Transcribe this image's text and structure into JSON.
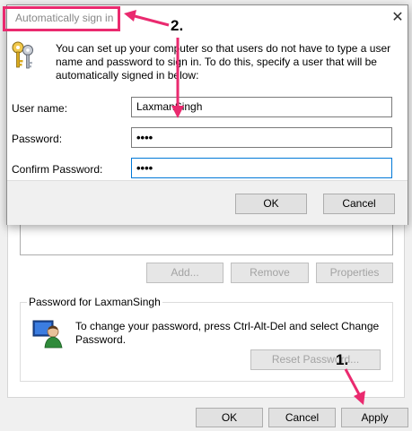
{
  "background": {
    "buttons": {
      "add": "Add...",
      "remove": "Remove",
      "properties": "Properties",
      "reset_password": "Reset Password...",
      "ok": "OK",
      "cancel": "Cancel",
      "apply": "Apply"
    },
    "password_group": {
      "title": "Password for LaxmanSingh",
      "text": "To change your password, press Ctrl-Alt-Del and select Change Password."
    }
  },
  "dialog": {
    "title": "Automatically sign in",
    "intro": "You can set up your computer so that users do not have to type a user name and password to sign in. To do this, specify a user that will be automatically signed in below:",
    "fields": {
      "username_label": "User name:",
      "username_value": "LaxmanSingh",
      "password_label": "Password:",
      "password_value": "••••",
      "confirm_label": "Confirm Password:",
      "confirm_value": "••••"
    },
    "buttons": {
      "ok": "OK",
      "cancel": "Cancel"
    },
    "close_glyph": "✕"
  },
  "annotations": {
    "step1": "1.",
    "step2": "2."
  },
  "colors": {
    "annotation": "#ea2a6f",
    "focus": "#0078d7"
  }
}
